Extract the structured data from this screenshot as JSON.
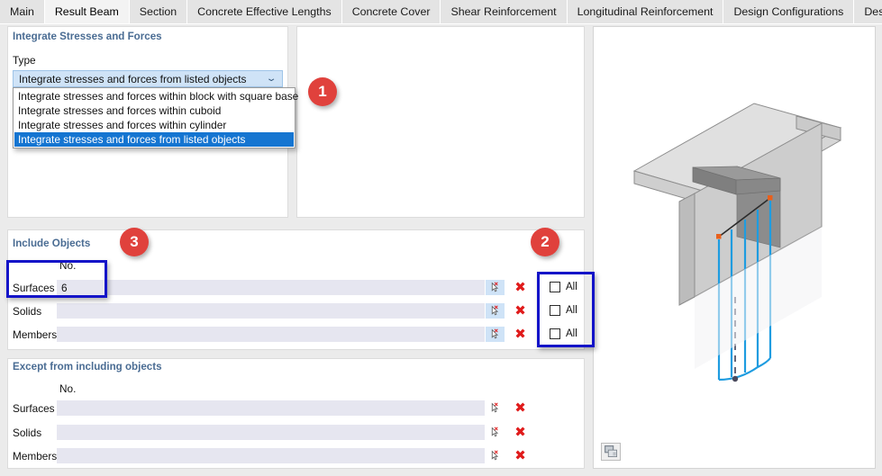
{
  "tabs": [
    {
      "label": "Main",
      "active": false
    },
    {
      "label": "Result Beam",
      "active": true
    },
    {
      "label": "Section",
      "active": false
    },
    {
      "label": "Concrete Effective Lengths",
      "active": false
    },
    {
      "label": "Concrete Cover",
      "active": false
    },
    {
      "label": "Shear Reinforcement",
      "active": false
    },
    {
      "label": "Longitudinal Reinforcement",
      "active": false
    },
    {
      "label": "Design Configurations",
      "active": false
    },
    {
      "label": "Design Suppor",
      "active": false
    }
  ],
  "tab_nav": {
    "prev_icon": "◀",
    "next_icon": "▶"
  },
  "integrate": {
    "group_title": "Integrate Stresses and Forces",
    "type_label": "Type",
    "selected": "Integrate stresses and forces from listed objects",
    "caret_icon": "⌄",
    "options": [
      "Integrate stresses and forces within block with square base",
      "Integrate stresses and forces within cuboid",
      "Integrate stresses and forces within cylinder",
      "Integrate stresses and forces from listed objects"
    ],
    "selected_index": 3
  },
  "include_objects": {
    "group_title": "Include Objects",
    "column_header": "No.",
    "rows": [
      {
        "label": "Surfaces",
        "value": "6",
        "all_label": "All",
        "all_checked": false
      },
      {
        "label": "Solids",
        "value": "",
        "all_label": "All",
        "all_checked": false
      },
      {
        "label": "Members",
        "value": "",
        "all_label": "All",
        "all_checked": false
      }
    ],
    "pick_icon": "pick-cursor-icon",
    "clear_icon": "✖"
  },
  "except_objects": {
    "group_title": "Except from including objects",
    "column_header": "No.",
    "rows": [
      {
        "label": "Surfaces",
        "value": ""
      },
      {
        "label": "Solids",
        "value": ""
      },
      {
        "label": "Members",
        "value": ""
      }
    ],
    "pick_icon": "pick-cursor-icon",
    "clear_icon": "✖"
  },
  "annotations": {
    "badges": [
      {
        "number": "1"
      },
      {
        "number": "2"
      },
      {
        "number": "3"
      }
    ],
    "badge_color": "#e0413c",
    "highlight_color": "#1414c8"
  },
  "viewport": {
    "snapshot_icon": "snapshot-icon",
    "model": "t-beam-with-result-beam-section"
  }
}
